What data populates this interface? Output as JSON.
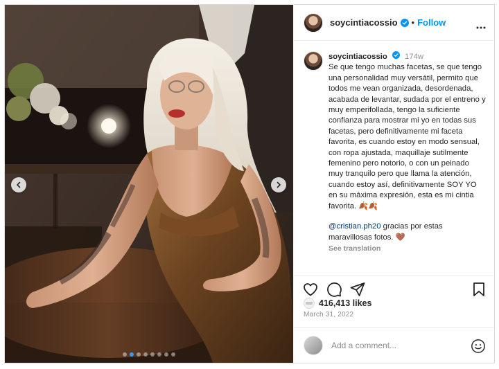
{
  "post": {
    "username": "soycintiacossio",
    "follow_label": "Follow",
    "separator": "•",
    "age": "174w",
    "caption": "Se que tengo muchas facetas, se que tengo una personalidad muy versátil, permito que todos me vean organizada, desordenada, acabada de levantar, sudada por el entreno y muy emperifollada, tengo la suficiente confianza para mostrar mi yo en todas sus facetas, pero definitivamente mi faceta favorita, es cuando estoy en modo sensual, con ropa ajustada, maquillaje sutilmente femenino pero notorio, o con un peinado muy tranquilo pero que llama la atención, cuando estoy así, definitivamente SOY YO en su máxima expresión, esta es mi cintia favorita. 🍂🍂",
    "mention": "@cristian.ph20",
    "comment_text": " gracias por estas maravillosas fotos. 🤎",
    "see_translation": "See translation",
    "likes": "416,413 likes",
    "date": "March 31, 2022",
    "add_comment_placeholder": "Add a comment..."
  },
  "carousel": {
    "total_slides": 8,
    "active_slide": 2
  },
  "icons": {
    "verified": "verified-badge-icon",
    "more": "more-options-icon",
    "like": "heart-icon",
    "comment": "comment-icon",
    "share": "share-icon",
    "save": "bookmark-icon",
    "emoji": "emoji-icon",
    "prev": "chevron-left-icon",
    "next": "chevron-right-icon"
  },
  "colors": {
    "link": "#0095f6",
    "mention": "#00376b",
    "verified": "#0095f6",
    "muted": "#8e8e8e"
  }
}
